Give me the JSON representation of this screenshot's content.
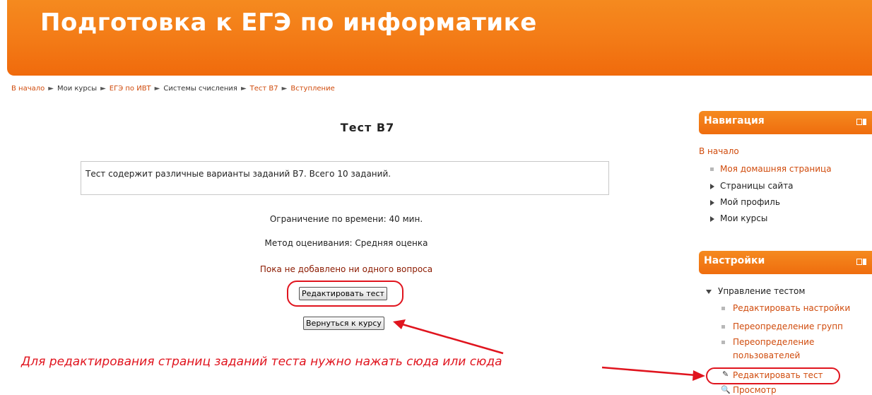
{
  "header": {
    "title": "Подготовка к ЕГЭ по информатике"
  },
  "breadcrumb": [
    {
      "label": "В начало",
      "link": true
    },
    {
      "label": "Мои курсы",
      "link": false
    },
    {
      "label": "ЕГЭ по ИВТ",
      "link": true
    },
    {
      "label": "Системы счисления",
      "link": false
    },
    {
      "label": "Тест B7",
      "link": true
    },
    {
      "label": "Вступление",
      "link": true
    }
  ],
  "main": {
    "title": "Тест B7",
    "intro": "Тест содержит различные варианты заданий B7. Всего 10 заданий.",
    "time_limit": "Ограничение по времени: 40 мин.",
    "grading_method": "Метод оценивания: Средняя оценка",
    "no_questions": "Пока не добавлено ни одного вопроса",
    "edit_button": "Редактировать тест",
    "back_button": "Вернуться к курсу"
  },
  "annotation": "Для редактирования страниц заданий теста нужно нажать сюда или сюда",
  "navigation": {
    "title": "Навигация",
    "home": "В начало",
    "items": [
      {
        "label": "Моя домашняя страница",
        "type": "link"
      },
      {
        "label": "Страницы сайта",
        "type": "collapsed"
      },
      {
        "label": "Мой профиль",
        "type": "collapsed"
      },
      {
        "label": "Мои курсы",
        "type": "collapsed"
      }
    ]
  },
  "settings": {
    "title": "Настройки",
    "section": "Управление тестом",
    "items": [
      {
        "label": "Редактировать настройки"
      },
      {
        "label": "Переопределение групп"
      },
      {
        "label": "Переопределение"
      },
      {
        "label": "пользователей"
      },
      {
        "label": "Редактировать тест"
      },
      {
        "label": "Просмотр"
      }
    ]
  },
  "colors": {
    "accent": "#f37a16",
    "link": "#d04b0c",
    "annotation": "#e0141e",
    "warning_text": "#8b1a00"
  },
  "icons": [
    "dock-icon",
    "bullet-icon",
    "expand-arrow-icon",
    "collapse-arrow-icon",
    "edit-icon",
    "preview-icon"
  ]
}
